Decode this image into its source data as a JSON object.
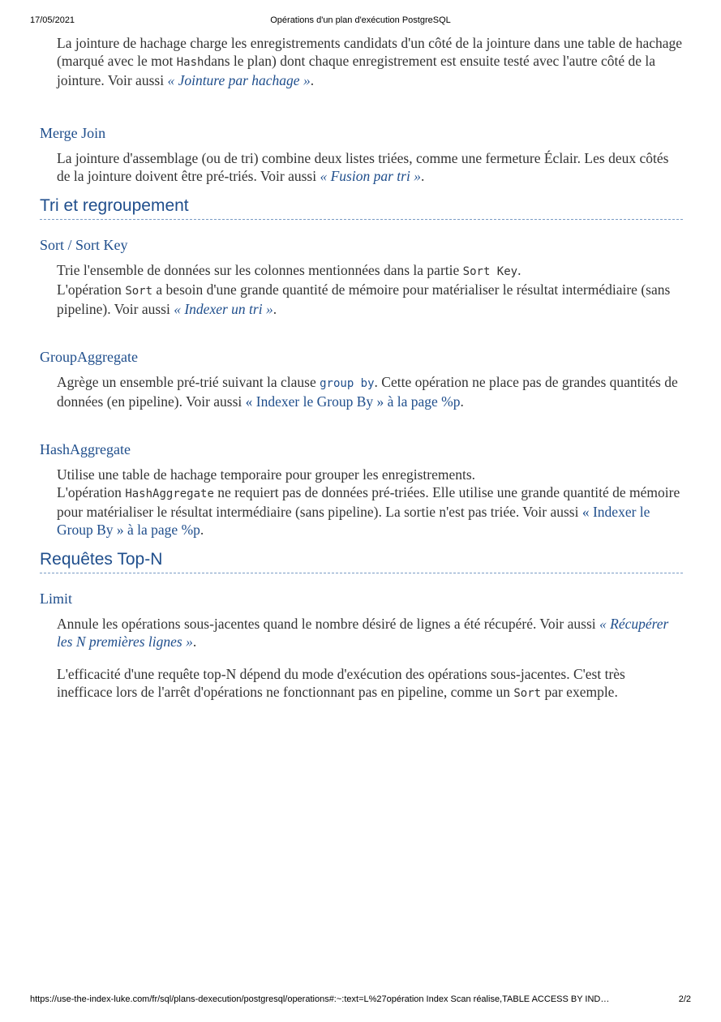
{
  "print": {
    "date": "17/05/2021",
    "title": "Opérations d'un plan d'exécution PostgreSQL",
    "url": "https://use-the-index-luke.com/fr/sql/plans-dexecution/postgresql/operations#:~:text=L%27opération Index Scan réalise,TABLE ACCESS BY IND…",
    "page": "2/2"
  },
  "hash_join": {
    "text1": "La jointure de hachage charge les enregistrements candidats d'un côté de la jointure dans une table de hachage (marqué avec le mot ",
    "code": "Hash",
    "text2": "dans le plan) dont chaque enregistrement est ensuite testé avec l'autre côté de la jointure. Voir aussi ",
    "link": "« Jointure par hachage »",
    "text3": "."
  },
  "merge_join": {
    "term": "Merge Join",
    "text1": "La jointure d'assemblage (ou de tri) combine deux listes triées, comme une fermeture Éclair. Les deux côtés de la jointure doivent être pré-triés. Voir aussi ",
    "link": "« Fusion par tri »",
    "text2": "."
  },
  "section_sort": {
    "title": "Tri et regroupement"
  },
  "sort": {
    "term": "Sort / Sort Key",
    "text1": "Trie l'ensemble de données sur les colonnes mentionnées dans la partie ",
    "code1": "Sort Key",
    "text2": ".",
    "text3": "L'opération ",
    "code2": "Sort",
    "text4": " a besoin d'une grande quantité de mémoire pour matérialiser le résultat intermédiaire (sans pipeline). Voir aussi ",
    "link": "« Indexer un tri »",
    "text5": "."
  },
  "group_aggregate": {
    "term": "GroupAggregate",
    "text1": "Agrège un ensemble pré-trié suivant la clause ",
    "code": "group by",
    "text2": ". Cette opération ne place pas de grandes quantités de données (en pipeline). Voir aussi ",
    "link": "« Indexer le Group By » à la page %p",
    "text3": "."
  },
  "hash_aggregate": {
    "term": "HashAggregate",
    "text1": "Utilise une table de hachage temporaire pour grouper les enregistrements.",
    "text2": "L'opération ",
    "code": "HashAggregate",
    "text3": " ne requiert pas de données pré-triées. Elle utilise une grande quantité de mémoire pour matérialiser le résultat intermédiaire (sans pipeline). La sortie n'est pas triée. Voir aussi ",
    "link": "« Indexer le Group By » à la page %p",
    "text4": "."
  },
  "section_topn": {
    "title": "Requêtes Top-N"
  },
  "limit": {
    "term": "Limit",
    "text1": "Annule les opérations sous-jacentes quand le nombre désiré de lignes a été récupéré. Voir aussi ",
    "link": "« Récupérer les N premières lignes »",
    "text2": ".",
    "p2_text1": "L'efficacité d'une requête top-N dépend du mode d'exécution des opérations sous-jacentes. C'est très inefficace lors de l'arrêt d'opérations ne fonctionnant pas en pipeline, comme un ",
    "p2_code": "Sort",
    "p2_text2": " par exemple."
  }
}
